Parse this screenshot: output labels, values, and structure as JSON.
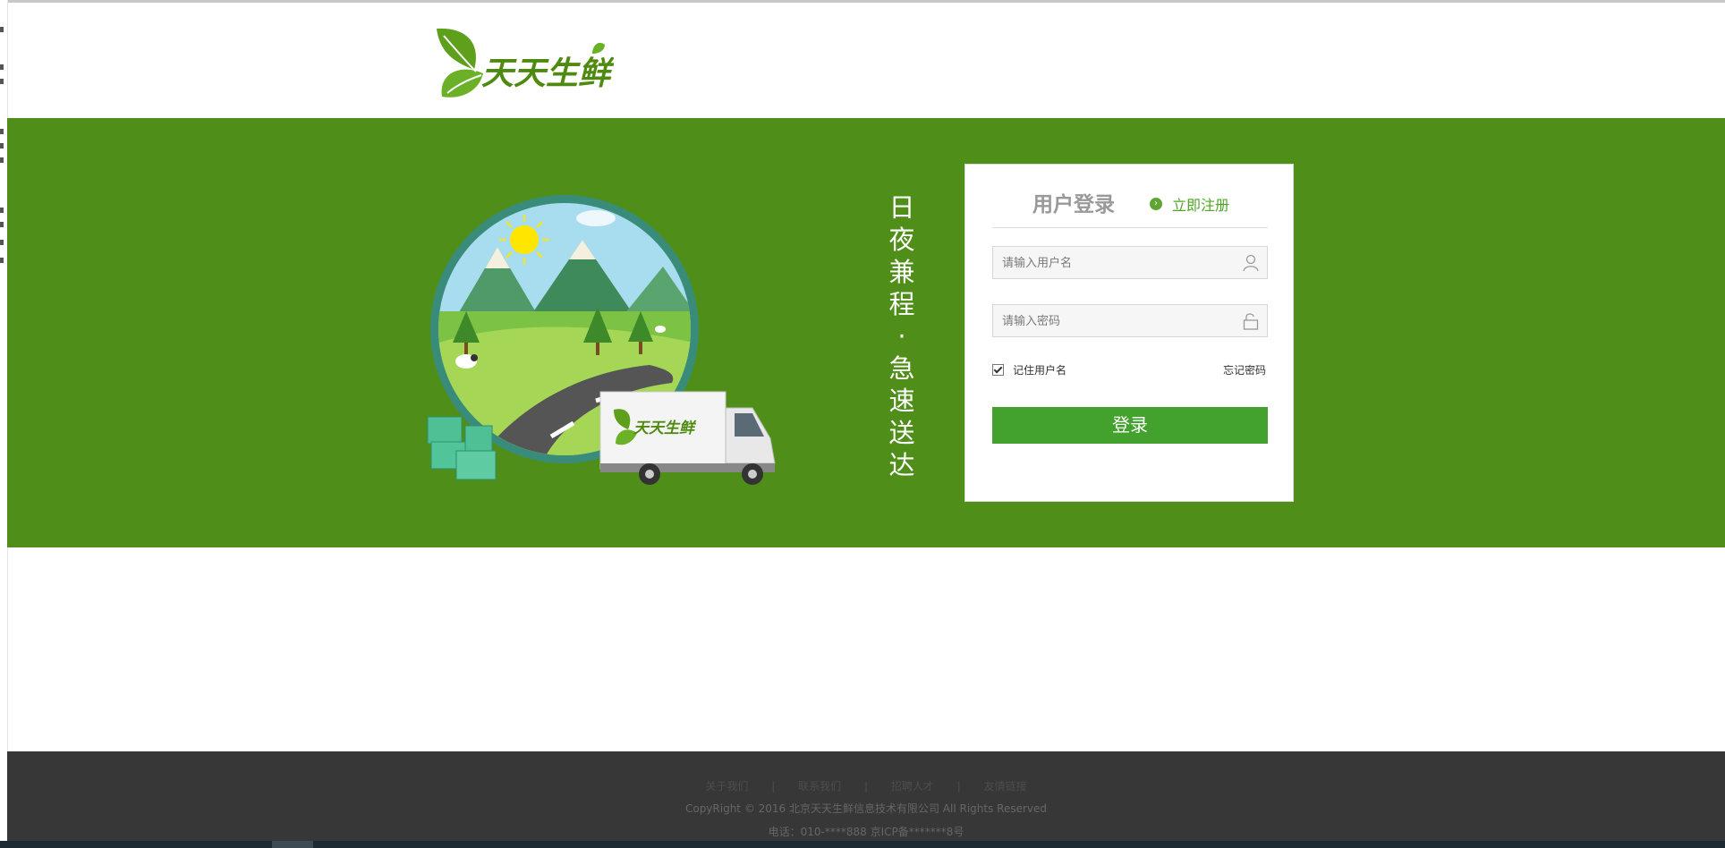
{
  "brand": {
    "logo_text": "天天生鲜",
    "green": "#4f8f19",
    "button_green": "#43a22e"
  },
  "banner": {
    "slogan_top": [
      "日",
      "夜",
      "兼",
      "程"
    ],
    "slogan_dot": "·",
    "slogan_bottom": [
      "急",
      "速",
      "送",
      "达"
    ],
    "truck_logo_text": "天天生鲜"
  },
  "login": {
    "title": "用户登录",
    "register_label": "立即注册",
    "username_placeholder": "请输入用户名",
    "password_placeholder": "请输入密码",
    "remember_label": "记住用户名",
    "remember_checked": true,
    "forgot_label": "忘记密码",
    "submit_label": "登录"
  },
  "footer": {
    "links": [
      "关于我们",
      "联系我们",
      "招聘人才",
      "友情链接"
    ],
    "separator": "|",
    "copyright": "CopyRight © 2016 北京天天生鲜信息技术有限公司 All Rights Reserved",
    "tel": "电话：010-****888 京ICP备*******8号"
  }
}
